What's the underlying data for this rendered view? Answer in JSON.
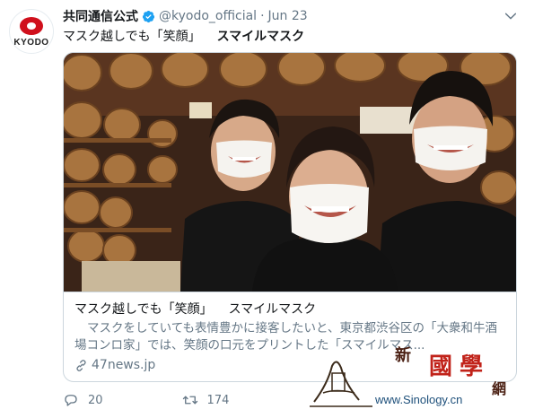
{
  "account": {
    "avatar_brand": "KYODO",
    "display_name": "共同通信公式",
    "handle": "@kyodo_official",
    "separator": "·",
    "date": "Jun 23"
  },
  "tweet": {
    "text_part1": "マスク越しでも「笑顔」",
    "text_part2": "スマイルマスク"
  },
  "card": {
    "photo_alt": "Three restaurant staff wearing masks printed with smiling mouths in a barrel-filled sake bar",
    "title_part1": "マスク越しでも「笑顔」",
    "title_part2": "スマイルマスク",
    "description": "マスクをしていても表情豊かに接客したいと、東京都渋谷区の「大衆和牛酒場コンロ家」では、笑顔の口元をプリントした「スマイルマス...",
    "domain": "47news.jp"
  },
  "actions": {
    "reply_count": "20",
    "retweet_count": "174"
  },
  "watermark": {
    "char1": "新",
    "chars": "國學",
    "char_last": "網",
    "url": "www.Sinology.cn"
  },
  "colors": {
    "text_primary": "#14171a",
    "text_secondary": "#657786",
    "border": "#ccd6dd",
    "verified": "#1da1f2",
    "kyodo_red": "#d0101c"
  }
}
